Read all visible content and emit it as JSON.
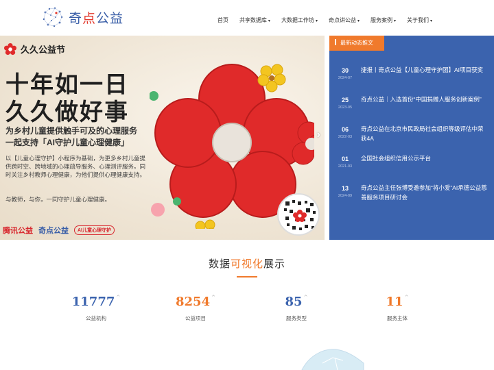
{
  "brand": {
    "name_pre": "奇",
    "name_dot": "点",
    "name_post": "公益"
  },
  "nav": [
    {
      "label": "首页",
      "has_menu": false
    },
    {
      "label": "共享数据库",
      "has_menu": true
    },
    {
      "label": "大数据工作坊",
      "has_menu": true
    },
    {
      "label": "奇点讲公益",
      "has_menu": true
    },
    {
      "label": "服务案例",
      "has_menu": true
    },
    {
      "label": "关于我们",
      "has_menu": true
    }
  ],
  "banner": {
    "festival": "久久公益节",
    "headline1": "十年如一日",
    "headline2": "久久做好事",
    "sub1": "为乡村儿童提供触手可及的心理服务",
    "sub2": "一起支持「AI守护儿童心理健康」",
    "desc": "以【儿童心理守护】小程序为基础，为更多乡村儿童提供跨时空、跨地域的心理疏导服务、心理测评服务。同时关注乡村教师心理健康，为他们提供心理健康支持。",
    "desc2": "与教师，与你，一同守护儿童心理健康。",
    "partners": [
      "腾讯公益",
      "奇点公益",
      "AI儿童心理守护"
    ],
    "next_arrow": "›"
  },
  "news": {
    "tab_label": "最新动态推文",
    "items": [
      {
        "day": "30",
        "ym": "2024-07",
        "title": "捷报丨奇点公益【儿童心理守护团】AI项目获奖"
      },
      {
        "day": "25",
        "ym": "2023-05",
        "title": "奇点公益｜入选首份“中国捐赠人服务创新案例”"
      },
      {
        "day": "06",
        "ym": "2022-03",
        "title": "奇点公益在北京市民政局社会组织等级评估中荣获4A"
      },
      {
        "day": "01",
        "ym": "2021-03",
        "title": "全国社会组织信用公示平台"
      },
      {
        "day": "13",
        "ym": "2024-09",
        "title": "奇点公益主任张博受邀参加“将小爱”AI承德公益慈善服务项目研讨会"
      }
    ]
  },
  "stats": {
    "title_pre": "数据",
    "title_hl": "可视化",
    "title_post": "展示",
    "up_glyph": "^",
    "items": [
      {
        "value": "11777",
        "label": "公益机构",
        "color": "#3b63ae"
      },
      {
        "value": "8254",
        "label": "公益项目",
        "color": "#f07a2c"
      },
      {
        "value": "85",
        "label": "服务类型",
        "color": "#3b63ae"
      },
      {
        "value": "11",
        "label": "服务主体",
        "color": "#f07a2c"
      }
    ]
  },
  "colors": {
    "accent_orange": "#f07a2c",
    "brand_blue": "#3b63ae",
    "flower_red": "#e02a2a"
  }
}
